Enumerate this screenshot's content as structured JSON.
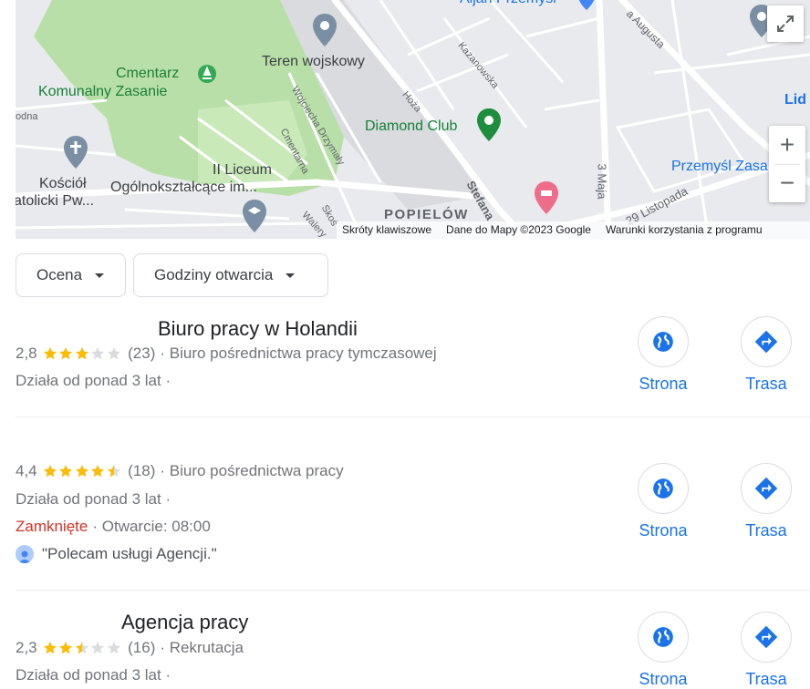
{
  "map": {
    "labels": {
      "cmentarz_line1": "Cmentarz",
      "cmentarz_line2": "Komunalny Zasanie",
      "teren": "Teren wojskowy",
      "diamond": "Diamond Club",
      "liceum_line1": "II Liceum",
      "liceum_line2": "Ogólnokształcące im...",
      "kosciol_line1": "Kościół",
      "kosciol_line2": "atolicki Pw...",
      "popielow": "POPIELÓW",
      "przemysl_zasanie": "Przemyśl Zasa",
      "aljan": "Aljan Przemyśl",
      "lid": "Lid",
      "odna": "odna"
    },
    "streets": {
      "augusta": "a Augusta",
      "kazanowska": "Kazanowska",
      "hoza": "Hoża",
      "drzymaly": "Wojciecha Drzymały",
      "cmentarna": "Cmentarna",
      "stefana": "Stefana",
      "maja": "3 Maja",
      "listopada": "29 Listopada",
      "skos": "Skoś",
      "walery": "Walery"
    },
    "attribution": {
      "shortcuts": "Skróty klawiszowe",
      "data": "Dane do Mapy ©2023 Google",
      "terms": "Warunki korzystania z programu"
    },
    "zoom_in": "+",
    "zoom_out": "−"
  },
  "filters": [
    {
      "label": "Ocena"
    },
    {
      "label": "Godziny otwarcia"
    }
  ],
  "results": [
    {
      "title": "Biuro pracy w Holandii",
      "rating": "2,8",
      "rating_value": 2.8,
      "reviews": "(23)",
      "category": "· Biuro pośrednictwa pracy tymczasowej",
      "years": "Działa od ponad 3 lat ·",
      "website_label": "Strona",
      "directions_label": "Trasa"
    },
    {
      "title": "",
      "rating": "4,4",
      "rating_value": 4.4,
      "reviews": "(18)",
      "category": "· Biuro pośrednictwa pracy",
      "years": "Działa od ponad 3 lat ·",
      "status_closed": "Zamknięte",
      "status_open": "· Otwarcie: 08:00",
      "quote": "\"Polecam usługi Agencji.\"",
      "website_label": "Strona",
      "directions_label": "Trasa"
    },
    {
      "title": "Agencja pracy",
      "rating": "2,3",
      "rating_value": 2.3,
      "reviews": "(16)",
      "category": "· Rekrutacja",
      "years": "Działa od ponad 3 lat ·",
      "website_label": "Strona",
      "directions_label": "Trasa"
    }
  ],
  "colors": {
    "star": "#fbbc04",
    "star_empty": "#dadce0",
    "accent": "#1a73e8",
    "closed": "#d93025"
  }
}
